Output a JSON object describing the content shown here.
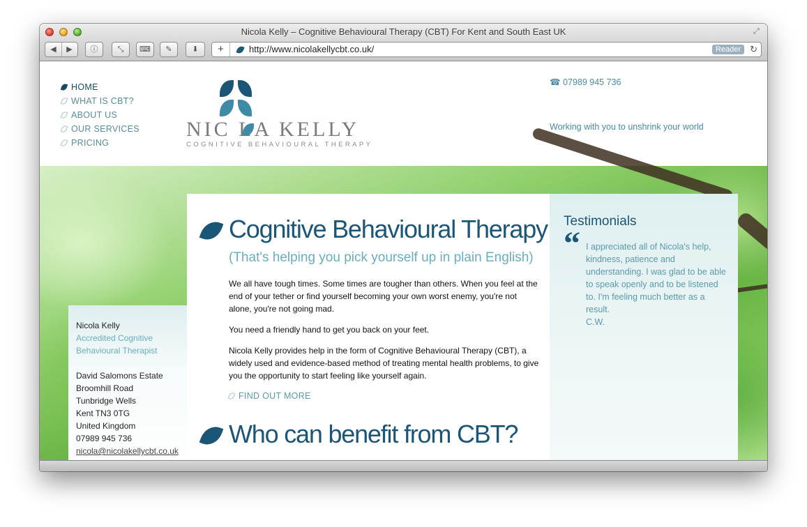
{
  "window": {
    "title": "Nicola Kelly – Cognitive Behavioural Therapy (CBT) For Kent and South East UK"
  },
  "toolbar": {
    "back_icon": "back-arrow-icon",
    "forward_icon": "forward-arrow-icon",
    "plus_label": "+",
    "url": "http://www.nicolakellycbt.co.uk/",
    "reader_label": "Reader",
    "reload_icon": "reload-icon"
  },
  "nav": {
    "items": [
      {
        "label": "HOME",
        "active": true
      },
      {
        "label": "WHAT IS CBT?"
      },
      {
        "label": "ABOUT US"
      },
      {
        "label": "OUR SERVICES"
      },
      {
        "label": "PRICING"
      }
    ]
  },
  "logo": {
    "name": "NIC LA KELLY",
    "subtitle": "COGNITIVE BEHAVIOURAL THERAPY"
  },
  "header": {
    "phone": "☎ 07989 945 736",
    "tagline": "Working with you to unshrink your world"
  },
  "contact": {
    "name": "Nicola Kelly",
    "role_line1": "Accredited Cognitive",
    "role_line2": "Behavioural Therapist",
    "address": [
      "David Salomons Estate",
      "Broomhill Road",
      "Tunbridge Wells",
      "Kent TN3 0TG",
      "United Kingdom"
    ],
    "phone": "07989 945 736",
    "email": "nicola@nicolakellycbt.co.uk"
  },
  "main": {
    "heading": "Cognitive Behavioural Therapy",
    "subheading": "(That's helping you pick yourself up in plain English)",
    "paragraphs": [
      "We all have tough times. Some times are tougher than others. When you feel at the end of your tether or find yourself becoming your own worst enemy, you're not alone, you're not going mad.",
      "You need a friendly hand to get you back on your feet.",
      "Nicola Kelly provides help in the form of Cognitive Behavioural Therapy (CBT), a widely used and evidence-based method of treating mental health problems, to give you the opportunity to start feeling like yourself again."
    ],
    "find_more": "FIND OUT MORE",
    "heading2": "Who can benefit from CBT?"
  },
  "testimonials": {
    "title": "Testimonials",
    "quote_mark": "“",
    "quote": "I appreciated all of Nicola's help, kindness, patience and understanding. I was glad to be able to speak openly and to be listened to. I'm feeling much better as a result.",
    "author": "C.W."
  },
  "colors": {
    "brand_dark": "#1b5677",
    "brand_teal": "#6aaebb",
    "nav_link": "#5a8a9a"
  }
}
